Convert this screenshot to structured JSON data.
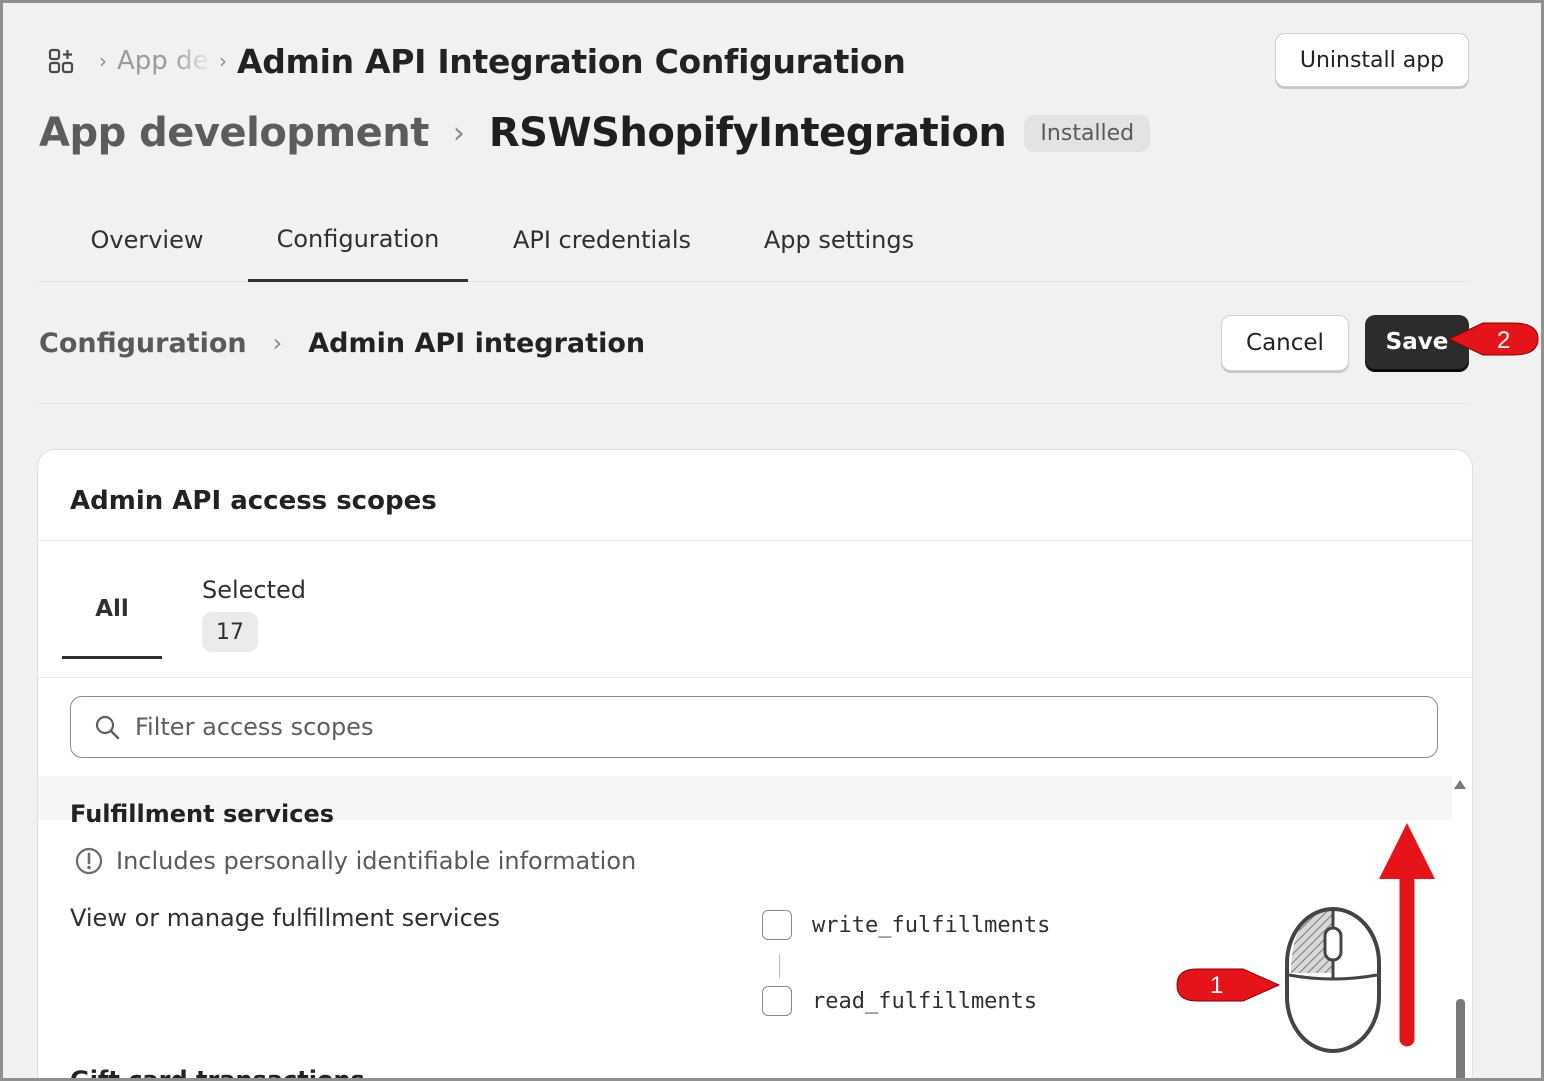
{
  "breadcrumb": {
    "parent_label": "App dev",
    "current_title": "Admin API Integration Configuration"
  },
  "header": {
    "uninstall_label": "Uninstall app",
    "parent_label": "App development",
    "app_name": "RSWShopifyIntegration",
    "status_badge": "Installed"
  },
  "tabs": [
    {
      "label": "Overview"
    },
    {
      "label": "Configuration"
    },
    {
      "label": "API credentials"
    },
    {
      "label": "App settings"
    }
  ],
  "subheader": {
    "parent_label": "Configuration",
    "current_label": "Admin API integration",
    "cancel_label": "Cancel",
    "save_label": "Save"
  },
  "scopes": {
    "title": "Admin API access scopes",
    "tab_all": "All",
    "tab_selected": "Selected",
    "selected_count": "17",
    "search_placeholder": "Filter access scopes",
    "section_title": "Fulfillment services",
    "pii_note": "Includes personally identifiable information",
    "description": "View or manage fulfillment services",
    "write_scope": "write_fulfillments",
    "read_scope": "read_fulfillments",
    "next_section_partial": "Gift card transactions"
  },
  "annotations": {
    "step1": "1",
    "step2": "2",
    "color": "#e5141b"
  },
  "icons": {
    "apps": "apps-grid-icon",
    "search": "search-icon",
    "info": "info-circle-icon",
    "mouse": "mouse-scroll-icon",
    "arrow": "red-arrow-up-icon"
  }
}
